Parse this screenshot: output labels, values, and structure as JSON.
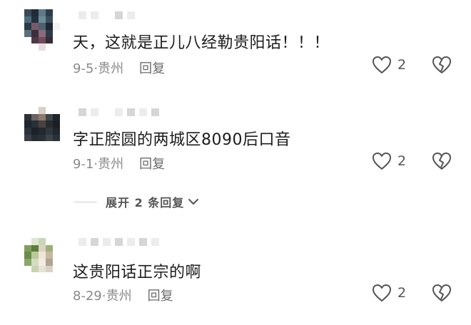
{
  "comments": [
    {
      "text": "天，这就是正儿八经勒贵阳话！！！",
      "date": "9-5",
      "location": "贵州",
      "reply_label": "回复",
      "likes": "2"
    },
    {
      "text": "字正腔圆的两城区8090后口音",
      "date": "9-1",
      "location": "贵州",
      "reply_label": "回复",
      "likes": "2"
    },
    {
      "text": "这贵阳话正宗的啊",
      "date": "8-29",
      "location": "贵州",
      "reply_label": "回复",
      "likes": "2"
    }
  ],
  "expand_replies": {
    "label": "展开 2 条回复"
  },
  "icons": {
    "like": "heart-outline-icon",
    "dislike": "broken-heart-icon",
    "expand": "chevron-down-icon"
  },
  "colors": {
    "text": "#1c1c1c",
    "meta": "#8a8a8a",
    "icon": "#555555"
  }
}
